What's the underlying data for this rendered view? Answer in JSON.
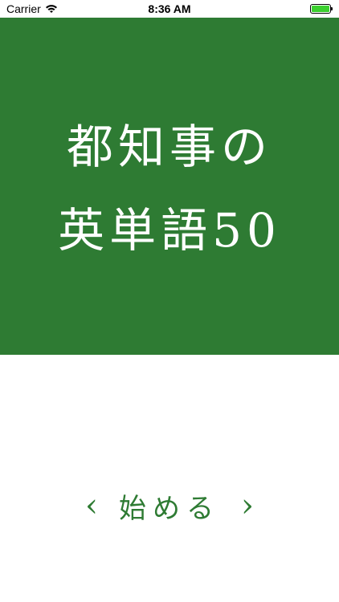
{
  "status": {
    "carrier": "Carrier",
    "time": "8:36 AM",
    "battery_color": "#3bd02f"
  },
  "hero": {
    "background": "#2e7b33",
    "title_line1": "都知事の",
    "title_line2": "英単語50"
  },
  "start": {
    "left_icon": "‹",
    "label": "始める",
    "right_icon": "›"
  }
}
